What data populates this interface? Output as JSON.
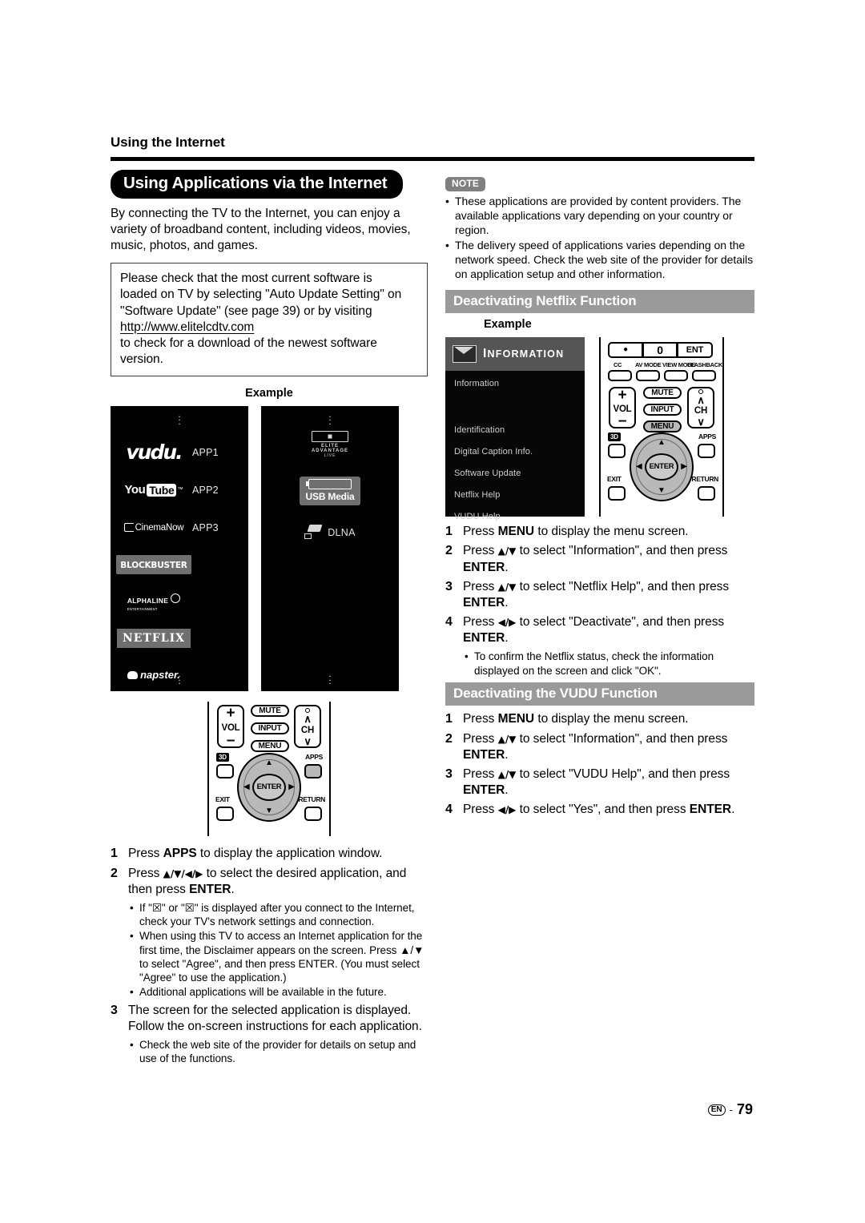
{
  "running_head": "Using the Internet",
  "section": {
    "title": "Using Applications via the Internet",
    "intro": "By connecting the TV to the Internet, you can enjoy a variety of broadband content, including videos, movies, music, photos, and games.",
    "notice": {
      "line1": "Please check that the most current software is",
      "line2": "loaded on TV by selecting \"Auto Update Setting\" on",
      "line3": "\"Software Update\" (see page 39) or by visiting",
      "url": "http://www.elitelcdtv.com",
      "line4": "to check for a download of the newest software version."
    },
    "example_caption": "Example"
  },
  "app_panel_1": {
    "dots": "⠇",
    "items": [
      {
        "logo": "vudu-logo",
        "label": "vudu.",
        "tag": "APP1"
      },
      {
        "logo": "youtube-logo",
        "label_you": "You",
        "label_tube": "Tube",
        "tm": "™",
        "tag": "APP2"
      },
      {
        "logo": "cinemanow-logo",
        "label": "CinemaNow",
        "tag": "APP3"
      },
      {
        "logo": "blockbuster-logo",
        "label": "BLOCKBUSTER",
        "tag": ""
      },
      {
        "logo": "alphaline-logo",
        "label": "ALPHALINE",
        "sub": "ENTERTAINMENT",
        "tag": ""
      },
      {
        "logo": "netflix-logo",
        "label": "NETFLIX",
        "tag": ""
      },
      {
        "logo": "napster-logo",
        "label": "napster.",
        "tag": ""
      }
    ]
  },
  "app_panel_2": {
    "dots": "⠇",
    "items": [
      {
        "logo": "elite-advantage-live-logo",
        "t1": "ELITE",
        "t2": "ADVANTAGE",
        "t3": "LIVE"
      },
      {
        "logo": "usb-media-icon",
        "label": "USB Media"
      },
      {
        "logo": "dlna-icon",
        "label": "DLNA"
      }
    ]
  },
  "remote_left": {
    "vol_plus": "+",
    "vol_label": "VOL",
    "vol_minus": "–",
    "mute": "MUTE",
    "input": "INPUT",
    "menu": "MENU",
    "ch_up": "∧",
    "ch_label": "CH",
    "ch_down": "∨",
    "three_d": "3D",
    "apps": "APPS",
    "exit": "EXIT",
    "return": "RETURN",
    "enter": "ENTER",
    "arrow_up": "▲",
    "arrow_down": "▼",
    "arrow_left": "◀",
    "arrow_right": "▶",
    "highlight": "APPS"
  },
  "remote_right": {
    "dot": "●",
    "zero": "0",
    "ent": "ENT",
    "cc": "CC",
    "av_mode": "AV MODE",
    "view_mode": "VIEW MODE",
    "flashback": "FLASHBACK",
    "vol_plus": "+",
    "vol_label": "VOL",
    "vol_minus": "–",
    "mute": "MUTE",
    "input": "INPUT",
    "menu": "MENU",
    "ch_up": "∧",
    "ch_label": "CH",
    "ch_down": "∨",
    "three_d": "3D",
    "apps": "APPS",
    "exit": "EXIT",
    "return": "RETURN",
    "enter": "ENTER",
    "arrow_up": "▲",
    "arrow_down": "▼",
    "arrow_left": "◀",
    "arrow_right": "▶",
    "highlight": "MENU"
  },
  "left_steps": {
    "s1_num": "1",
    "s1_text_pre": "Press ",
    "s1_kw": "APPS",
    "s1_text_post": " to display the application window.",
    "s2_num": "2",
    "s2_text_pre": "Press ",
    "s2_arrows": "▲/▼/◀/▶",
    "s2_text_mid": " to select the desired application, and then press ",
    "s2_kw": "ENTER",
    "s2_text_post": ".",
    "s2_bullets": [
      "If \"☒\" or \"☒\" is displayed after you connect to the Internet, check your TV's network settings and connection.",
      "When using this TV to access an Internet application for the first time, the Disclaimer appears on the screen. Press ▲/▼ to select \"Agree\", and then press ENTER. (You must select \"Agree\" to use the application.)",
      "Additional applications will be available in the future."
    ],
    "s3_num": "3",
    "s3_text": "The screen for the selected application is displayed. Follow the on-screen instructions for each application.",
    "s3_bullets": [
      "Check the web site of the provider for details on setup and use of the functions."
    ]
  },
  "note": {
    "badge": "NOTE",
    "items": [
      "These applications are provided by content providers. The available applications vary depending on your country or region.",
      "The delivery speed of applications varies depending on the network speed. Check the web site of the provider for details on application setup and other information."
    ]
  },
  "netflix_section": {
    "bar_title": "Deactivating Netflix Function",
    "example_caption": "Example",
    "osd": {
      "header_first": "I",
      "header_rest": "NFORMATION",
      "items": [
        "Information",
        "",
        "Identification",
        "Digital Caption Info.",
        "Software Update",
        "Netflix Help",
        "VUDU Help"
      ]
    },
    "steps": [
      {
        "num": "1",
        "pre": "Press ",
        "kw": "MENU",
        "post": " to display the menu screen."
      },
      {
        "num": "2",
        "pre": "Press ",
        "arrows": "▲/▼",
        "mid": " to select \"Information\", and then press ",
        "kw": "ENTER",
        "post": "."
      },
      {
        "num": "3",
        "pre": "Press ",
        "arrows": "▲/▼",
        "mid": " to select \"Netflix Help\", and then press ",
        "kw": "ENTER",
        "post": "."
      },
      {
        "num": "4",
        "pre": "Press ",
        "arrows": "◀/▶",
        "mid": " to select \"Deactivate\", and then press ",
        "kw": "ENTER",
        "post": "."
      }
    ],
    "bullet": "To confirm the Netflix status, check the information displayed on the screen and click \"OK\"."
  },
  "vudu_section": {
    "bar_title": "Deactivating the VUDU Function",
    "steps": [
      {
        "num": "1",
        "pre": "Press ",
        "kw": "MENU",
        "post": " to display the menu screen."
      },
      {
        "num": "2",
        "pre": "Press ",
        "arrows": "▲/▼",
        "mid": " to select \"Information\", and then press ",
        "kw": "ENTER",
        "post": "."
      },
      {
        "num": "3",
        "pre": "Press ",
        "arrows": "▲/▼",
        "mid": " to select \"VUDU Help\", and then press ",
        "kw": "ENTER",
        "post": "."
      },
      {
        "num": "4",
        "pre": "Press ",
        "arrows": "◀/▶",
        "mid": " to select \"Yes\", and then press ",
        "kw": "ENTER",
        "post": "."
      }
    ]
  },
  "footer": {
    "lang": "EN",
    "dash": "-",
    "page": "79"
  },
  "colors": {
    "title_pill_bg": "#000000",
    "gray_bar_bg": "#9a9a9a",
    "note_badge_bg": "#808080",
    "panel_bg": "#010101",
    "highlight_button": "#b9b9b9"
  }
}
